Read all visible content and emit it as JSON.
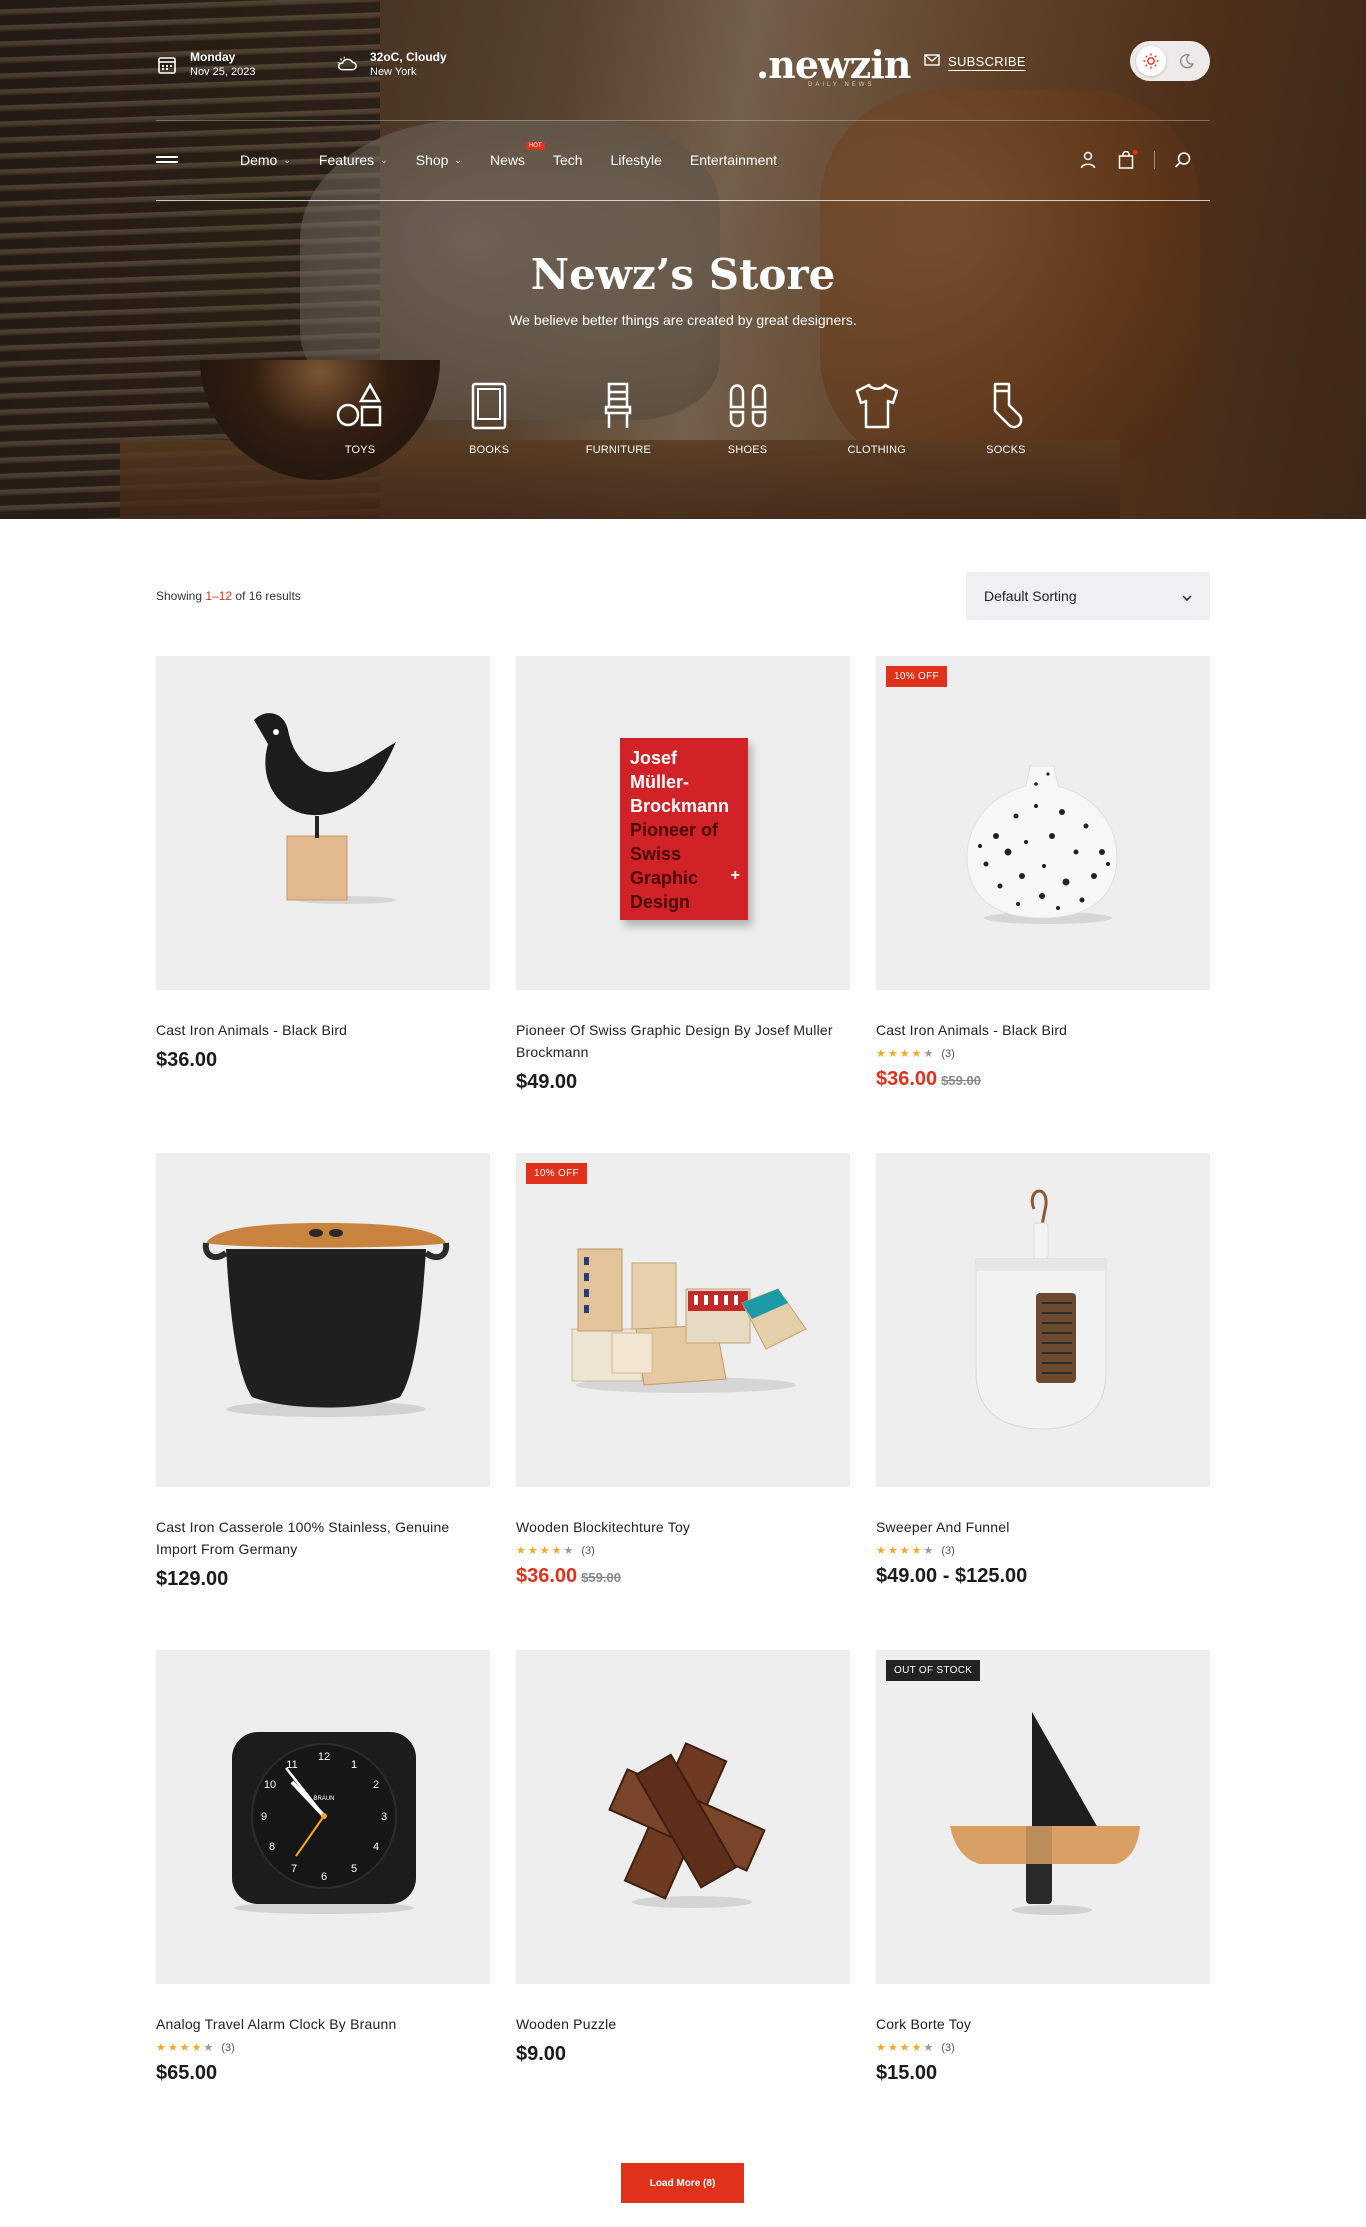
{
  "header": {
    "date": {
      "day": "Monday",
      "date": "Nov 25, 2023"
    },
    "weather": {
      "temp": "32oC, Cloudy",
      "city": "New York"
    },
    "logo": ".newzin",
    "logo_sub": "DAILY NEWS",
    "subscribe": "SUBSCRIBE",
    "nav": [
      {
        "label": "Demo",
        "dropdown": true
      },
      {
        "label": "Features",
        "dropdown": true
      },
      {
        "label": "Shop",
        "dropdown": true
      },
      {
        "label": "News",
        "dropdown": false,
        "badge": "HOT"
      },
      {
        "label": "Tech",
        "dropdown": false
      },
      {
        "label": "Lifestyle",
        "dropdown": false
      },
      {
        "label": "Entertainment",
        "dropdown": false
      }
    ]
  },
  "hero": {
    "title": "Newz’s Store",
    "subtitle": "We believe better things are created by great designers.",
    "categories": [
      "TOYS",
      "BOOKS",
      "FURNITURE",
      "SHOES",
      "CLOTHING",
      "SOCKS"
    ]
  },
  "shop": {
    "results_prefix": "Showing ",
    "results_range": "1–12",
    "results_suffix": " of 16 results",
    "sorting": "Default Sorting",
    "products": [
      {
        "name": "Cast Iron Animals - Black Bird",
        "price": "$36.00",
        "old_price": "",
        "rating_count": "",
        "badge": ""
      },
      {
        "name": "Pioneer Of Swiss Graphic Design By Josef Muller Brockmann",
        "price": "$49.00",
        "old_price": "",
        "rating_count": "",
        "badge": ""
      },
      {
        "name": "Cast Iron Animals - Black Bird",
        "price": "$36.00",
        "old_price": "$59.00",
        "rating_count": "(3)",
        "badge": "10% OFF"
      },
      {
        "name": "Cast Iron Casserole 100% Stainless, Genuine Import From Germany",
        "price": "$129.00",
        "old_price": "",
        "rating_count": "",
        "badge": ""
      },
      {
        "name": "Wooden Blockitechture Toy",
        "price": "$36.00",
        "old_price": "$59.00",
        "rating_count": "(3)",
        "badge": "10% OFF"
      },
      {
        "name": "Sweeper And Funnel",
        "price": "$49.00 - $125.00",
        "old_price": "",
        "rating_count": "(3)",
        "badge": ""
      },
      {
        "name": "Analog Travel Alarm Clock By Braunn",
        "price": "$65.00",
        "old_price": "",
        "rating_count": "(3)",
        "badge": ""
      },
      {
        "name": "Wooden Puzzle",
        "price": "$9.00",
        "old_price": "",
        "rating_count": "",
        "badge": ""
      },
      {
        "name": "Cork Borte Toy",
        "price": "$15.00",
        "old_price": "",
        "rating_count": "(3)",
        "badge": "OUT OF STOCK"
      }
    ],
    "book_cover_text": [
      "Josef",
      "Müller-",
      "Brockmann",
      "Pioneer of",
      "Swiss",
      "Graphic",
      "Design"
    ],
    "clock_brand": "BRAUN",
    "load_more": "Load More (8)"
  },
  "colors": {
    "accent": "#e0311b",
    "star": "#f6a623",
    "thumb_bg": "#eeeeee",
    "sort_bg": "#eef0f2"
  }
}
